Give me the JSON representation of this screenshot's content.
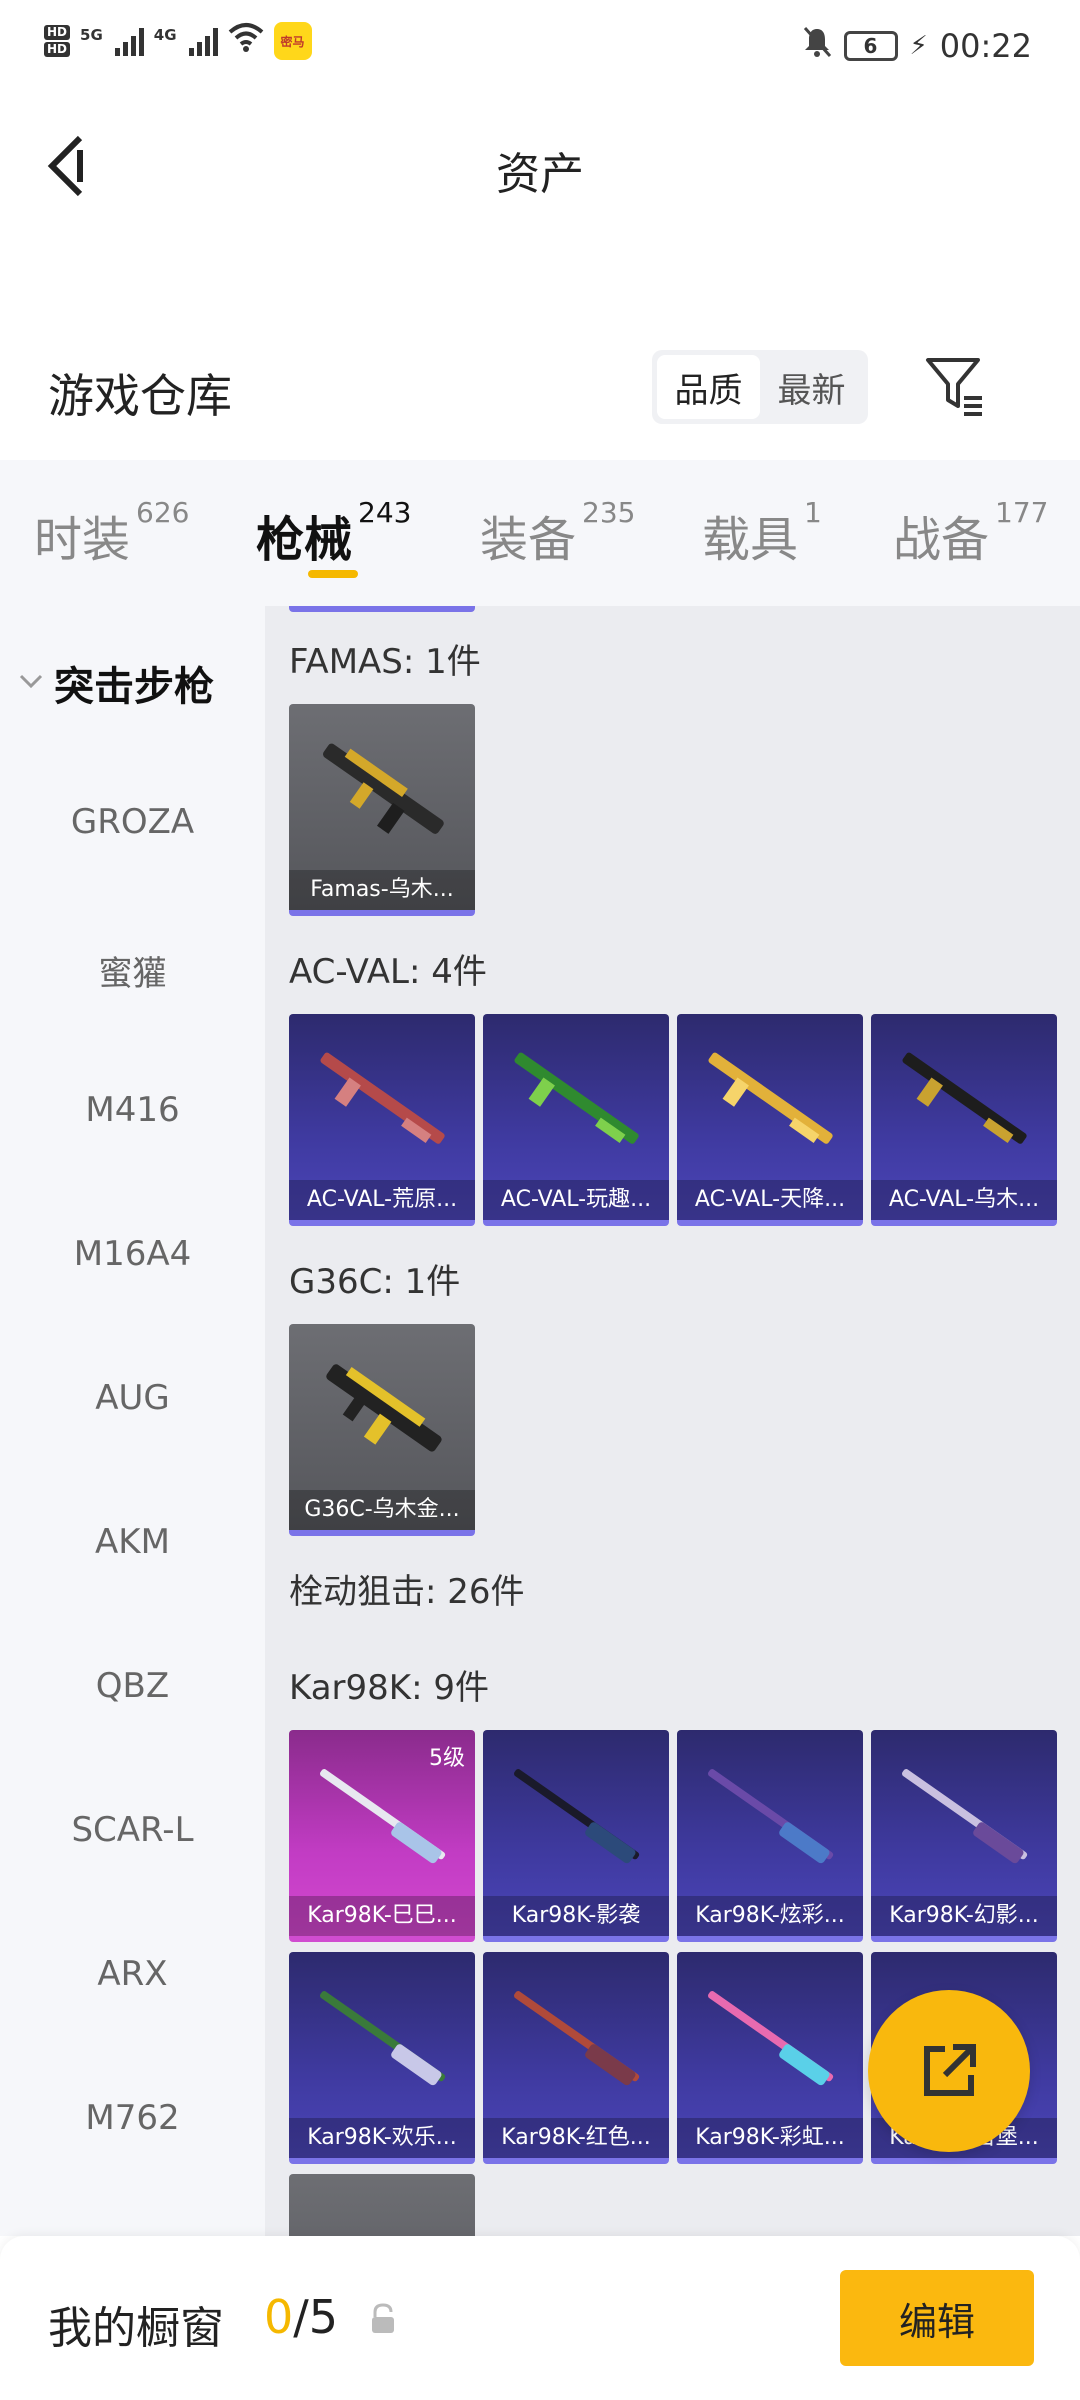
{
  "status_bar": {
    "hd_top": "HD",
    "hd_bottom": "HD",
    "net1": "5G",
    "net2": "4G",
    "app_icon_text": "密马",
    "battery": "6",
    "time": "00:22"
  },
  "header": {
    "title": "资产",
    "back_icon": "chevron-left-icon"
  },
  "warehouse": {
    "title": "游戏仓库",
    "sort_options": [
      "品质",
      "最新"
    ],
    "sort_selected": "品质",
    "filter_icon": "filter-icon"
  },
  "tabs": [
    {
      "label": "时装",
      "count": "626"
    },
    {
      "label": "枪械",
      "count": "243",
      "active": true
    },
    {
      "label": "装备",
      "count": "235"
    },
    {
      "label": "载具",
      "count": "1"
    },
    {
      "label": "战备",
      "count": "177"
    }
  ],
  "sidebar": {
    "group": "突击步枪",
    "items": [
      "GROZA",
      "蜜獾",
      "M416",
      "M16A4",
      "AUG",
      "AKM",
      "QBZ",
      "SCAR-L",
      "ARX",
      "M762"
    ]
  },
  "content": {
    "groups": [
      {
        "label": "FAMAS: 1件",
        "items": [
          {
            "name": "Famas-乌木...",
            "style": "gray"
          }
        ]
      },
      {
        "label": "AC-VAL: 4件",
        "items": [
          {
            "name": "AC-VAL-荒原...",
            "style": "purple"
          },
          {
            "name": "AC-VAL-玩趣...",
            "style": "purple"
          },
          {
            "name": "AC-VAL-天降...",
            "style": "purple"
          },
          {
            "name": "AC-VAL-乌木...",
            "style": "purple"
          }
        ]
      },
      {
        "label": "G36C: 1件",
        "items": [
          {
            "name": "G36C-乌木金...",
            "style": "gray"
          }
        ]
      },
      {
        "label": "栓动狙击: 26件",
        "items": []
      },
      {
        "label": "Kar98K: 9件",
        "items": [
          {
            "name": "Kar98K-巳巳...",
            "style": "pink",
            "level": "5级"
          },
          {
            "name": "Kar98K-影袭",
            "style": "purple"
          },
          {
            "name": "Kar98K-炫彩...",
            "style": "purple"
          },
          {
            "name": "Kar98K-幻影...",
            "style": "purple"
          },
          {
            "name": "Kar98K-欢乐...",
            "style": "purple"
          },
          {
            "name": "Kar98K-红色...",
            "style": "purple"
          },
          {
            "name": "Kar98K-彩虹...",
            "style": "purple"
          },
          {
            "name": "Kar98K-古堡...",
            "style": "purple"
          }
        ]
      }
    ]
  },
  "fab": {
    "icon": "share-external-icon"
  },
  "bottom_bar": {
    "title": "我的橱窗",
    "current": "0",
    "separator": "/",
    "total": "5",
    "lock_icon": "lock-icon",
    "edit_label": "编辑"
  },
  "colors": {
    "accent": "#f5b800",
    "card_purple": "#3f3aa0",
    "card_pink": "#c23cc4",
    "card_gray": "#5f6065"
  }
}
